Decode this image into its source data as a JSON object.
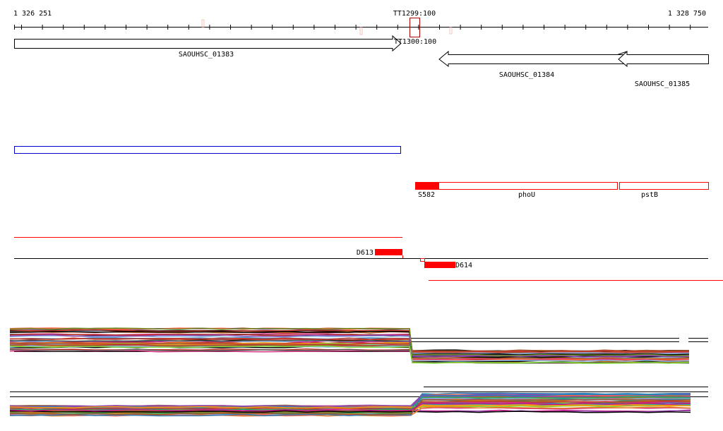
{
  "scale": {
    "start_label": "1 326 251",
    "end_label": "1 328 750",
    "tick_count": 34
  },
  "terminators": {
    "top_label": "TT1299:100",
    "bottom_label": "TT1300:100"
  },
  "genes": [
    {
      "name": "SAOUHSC_01383",
      "strand": "+"
    },
    {
      "name": "SAOUHSC_01384",
      "strand": "-"
    },
    {
      "name": "SAOUHSC_01385",
      "strand": "-"
    }
  ],
  "features": {
    "segment_label": "S582",
    "phoU_label": "phoU",
    "pstB_label": "pstB",
    "d613_label": "D613",
    "d614_label": "D614"
  },
  "colors": {
    "red": "#ff0000",
    "blue": "#0000cc",
    "dark_red": "#aa0000",
    "pink": "#f4c4b8",
    "expression_palette": [
      "#c0392b",
      "#e67e22",
      "#8e7b2a",
      "#27ae60",
      "#7fd631",
      "#2980b9",
      "#85b7e8",
      "#8e44ad",
      "#d63384",
      "#b5651d",
      "#555555",
      "#f39c12",
      "#c71585",
      "#6b8e23",
      "#ff6347",
      "#000000",
      "#a0522d",
      "#20b2aa"
    ]
  }
}
